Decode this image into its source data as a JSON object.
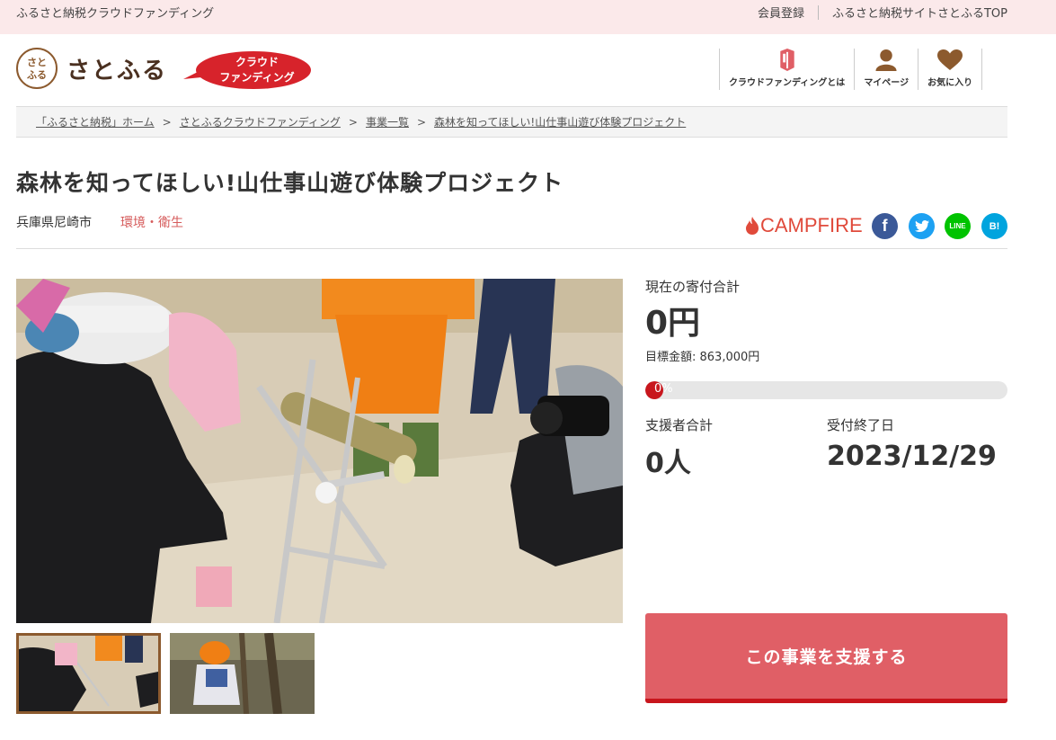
{
  "topbar": {
    "site_label": "ふるさと納税クラウドファンディング",
    "links": [
      "会員登録",
      "ふるさと納税サイトさとふるTOP"
    ]
  },
  "header": {
    "logo_text": "さとふる",
    "logo_mark": "さとふる",
    "badge_line1": "クラウド",
    "badge_line2": "ファンディング",
    "nav": [
      {
        "label": "クラウドファンディングとは",
        "icon": "info-book-icon"
      },
      {
        "label": "マイページ",
        "icon": "user-icon"
      },
      {
        "label": "お気に入り",
        "icon": "heart-icon"
      }
    ]
  },
  "breadcrumb": [
    "「ふるさと納税」ホーム",
    "さとふるクラウドファンディング",
    "事業一覧",
    "森林を知ってほしい!山仕事山遊び体験プロジェクト"
  ],
  "project": {
    "title": "森林を知ってほしい!山仕事山遊び体験プロジェクト",
    "location": "兵庫県尼崎市",
    "category": "環境・衛生",
    "partner": "CAMPFIRE"
  },
  "share": {
    "facebook": "f",
    "twitter": "t",
    "line": "LINE",
    "hatena": "B!"
  },
  "stats": {
    "total_label": "現在の寄付合計",
    "total_amount": "0円",
    "goal_text": "目標金額: 863,000円",
    "progress_text": "0%",
    "progress_fraction": 0.0,
    "supporters_label": "支援者合計",
    "supporters_value": "0人",
    "deadline_label": "受付終了日",
    "deadline_value": "2023/12/29"
  },
  "cta": {
    "support_label": "この事業を支援する"
  },
  "colors": {
    "accent": "#e05f66",
    "accent_dark": "#c8161d",
    "topbar_bg": "#fbe9ea",
    "category": "#d65c5c",
    "brand_brown": "#8c5a2e"
  }
}
